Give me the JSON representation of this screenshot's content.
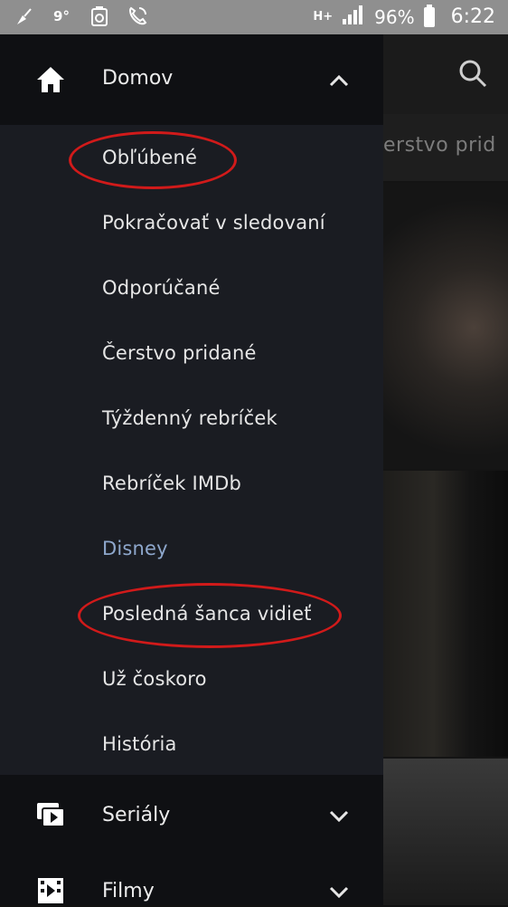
{
  "status_bar": {
    "signal_type": "H+",
    "battery": "96%",
    "time": "6:22",
    "left_icons": [
      "broom-icon",
      "temperature-icon",
      "recycle-icon",
      "phone-wifi-icon"
    ],
    "temp": "9°"
  },
  "background": {
    "subtab_text": "erstvo prid",
    "search_icon": "search-icon"
  },
  "drawer": {
    "home": {
      "label": "Domov",
      "icon": "home-icon",
      "expanded": true
    },
    "sub_items": [
      {
        "label": "Obľúbené"
      },
      {
        "label": "Pokračovať v sledovaní"
      },
      {
        "label": "Odporúčané"
      },
      {
        "label": "Čerstvo pridané"
      },
      {
        "label": "Týždenný rebríček"
      },
      {
        "label": "Rebríček IMDb"
      },
      {
        "label": "Disney",
        "active": true
      },
      {
        "label": "Posledná šanca vidieť"
      },
      {
        "label": "Už čoskoro"
      },
      {
        "label": "História"
      }
    ],
    "series": {
      "label": "Seriály",
      "icon": "series-icon"
    },
    "movies": {
      "label": "Filmy",
      "icon": "film-icon"
    }
  },
  "colors": {
    "accent_active": "#8ea7cc",
    "annotation": "#d11a1a"
  }
}
